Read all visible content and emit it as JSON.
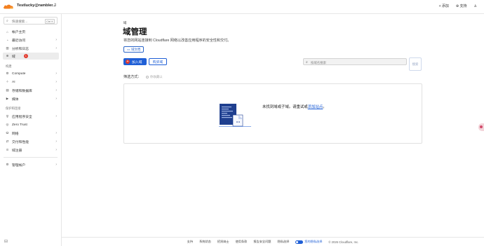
{
  "account": {
    "name": "Testlucky@rambler..."
  },
  "top_actions": [
    {
      "icon": "plus-icon",
      "label": "+ 添加"
    },
    {
      "icon": "help-icon",
      "label": "⊕ 支持"
    },
    {
      "icon": "user-icon",
      "label": "♙"
    }
  ],
  "sidebar": {
    "search_placeholder": "快速搜索...",
    "search_shortcut": "Ctrl K",
    "items_top": [
      {
        "icon": "home-icon",
        "glyph": "⌂",
        "label": "帐户主页",
        "chevron": ""
      },
      {
        "icon": "analytics-icon",
        "glyph": "◔",
        "label": "最近访问",
        "chevron": "›"
      },
      {
        "icon": "chart-icon",
        "glyph": "▥",
        "label": "分析和日志",
        "chevron": "›"
      },
      {
        "icon": "globe-icon",
        "glyph": "⊕",
        "label": "域",
        "chevron": "",
        "active": true,
        "badge": "1"
      }
    ],
    "section_build": "构建",
    "items_build": [
      {
        "icon": "compute-icon",
        "glyph": "⚙",
        "label": "Compute",
        "chevron": "›"
      },
      {
        "icon": "ai-icon",
        "glyph": "✧",
        "label": "AI",
        "chevron": "›"
      },
      {
        "icon": "storage-icon",
        "glyph": "▤",
        "label": "存储和数据库",
        "chevron": "›"
      },
      {
        "icon": "media-icon",
        "glyph": "▶",
        "label": "媒体",
        "chevron": "›"
      }
    ],
    "section_protect": "保护和连接",
    "items_protect": [
      {
        "icon": "shield-icon",
        "glyph": "⛨",
        "label": "应用程序安全",
        "chevron": "›"
      },
      {
        "icon": "zero-trust-icon",
        "glyph": "◎",
        "label": "Zero Trust",
        "chevron": ""
      },
      {
        "icon": "network-icon",
        "glyph": "⛁",
        "label": "网络",
        "chevron": "›"
      },
      {
        "icon": "delivery-icon",
        "glyph": "⇄",
        "label": "交付和性能",
        "chevron": "›"
      },
      {
        "icon": "domain-registration-icon",
        "glyph": "⊙",
        "label": "域注册",
        "chevron": "›"
      }
    ],
    "items_bottom": [
      {
        "icon": "settings-icon",
        "glyph": "⚙",
        "label": "管理帐户",
        "chevron": "›"
      }
    ],
    "collapse_glyph": "⊟"
  },
  "main": {
    "breadcrumb": "域",
    "title": "域管理",
    "description": "将您的网站连接到 Cloudflare 网络以改善应用程序的安全性和交付。",
    "doc_link": "域文档",
    "add_button": "加入域",
    "buy_button": "购买域",
    "domain_search_placeholder": "按域名搜索",
    "search_button": "搜索",
    "filter_label": "筛选方式：",
    "filter_option": "你收藏以",
    "empty_text_prefix": "未找到域或子域。请重试或",
    "empty_text_link": "添加站点",
    "empty_text_suffix": "。"
  },
  "footer": {
    "links": [
      "支持",
      "系统状态",
      "招贤纳士",
      "使用条款",
      "报告安全问题"
    ],
    "cookie_pref": "隐私选择",
    "privacy_label": "您的隐私选择",
    "copyright": "© 2026 Cloudflare, Inc."
  },
  "colors": {
    "accent": "#1f5fd6",
    "badge": "#e23b2e",
    "logo": "#f38020"
  }
}
